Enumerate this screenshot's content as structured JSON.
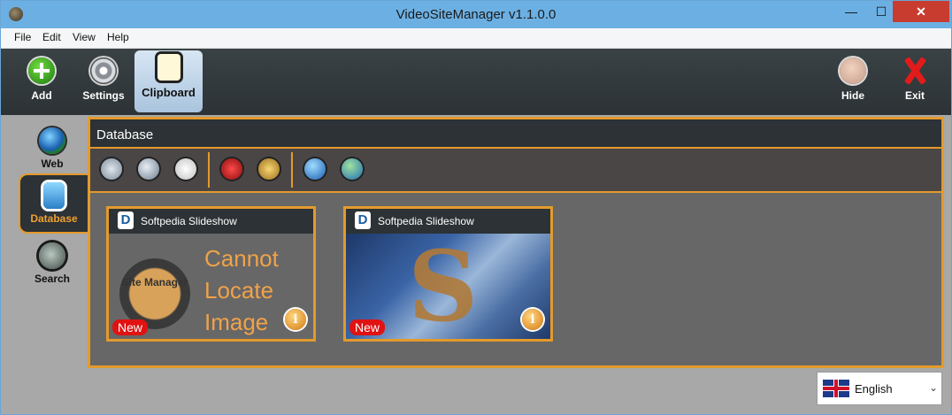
{
  "window": {
    "title": "VideoSiteManager v1.1.0.0",
    "min": "—",
    "max": "☐",
    "close": "✕"
  },
  "menu": [
    "File",
    "Edit",
    "View",
    "Help"
  ],
  "toolbar": {
    "add": "Add",
    "settings": "Settings",
    "clipboard": "Clipboard",
    "hide": "Hide",
    "exit": "Exit"
  },
  "sidebar": {
    "items": [
      {
        "label": "Web",
        "icon": "globe-icon"
      },
      {
        "label": "Database",
        "icon": "database-icon",
        "active": true
      },
      {
        "label": "Search",
        "icon": "search-icon"
      }
    ]
  },
  "panel": {
    "title": "Database",
    "tools": [
      "zoom-fit-icon",
      "magnifier-icon",
      "edit-notes-icon",
      "delete-icon",
      "clean-broom-icon",
      "globe-icon",
      "globe-green-icon"
    ]
  },
  "cards": [
    {
      "title": "Softpedia Slideshow",
      "badge": "New",
      "image_text": [
        "Cannot",
        "Locate",
        "Image"
      ],
      "logo_text": "Site Manager",
      "info": "i"
    },
    {
      "title": "Softpedia Slideshow",
      "badge": "New",
      "image_text": "S",
      "info": "i"
    }
  ],
  "language": {
    "selected": "English"
  },
  "colors": {
    "accent": "#e39a2b",
    "dark": "#2c3235",
    "titlebar": "#6cb0e3",
    "close": "#c83c2f"
  }
}
